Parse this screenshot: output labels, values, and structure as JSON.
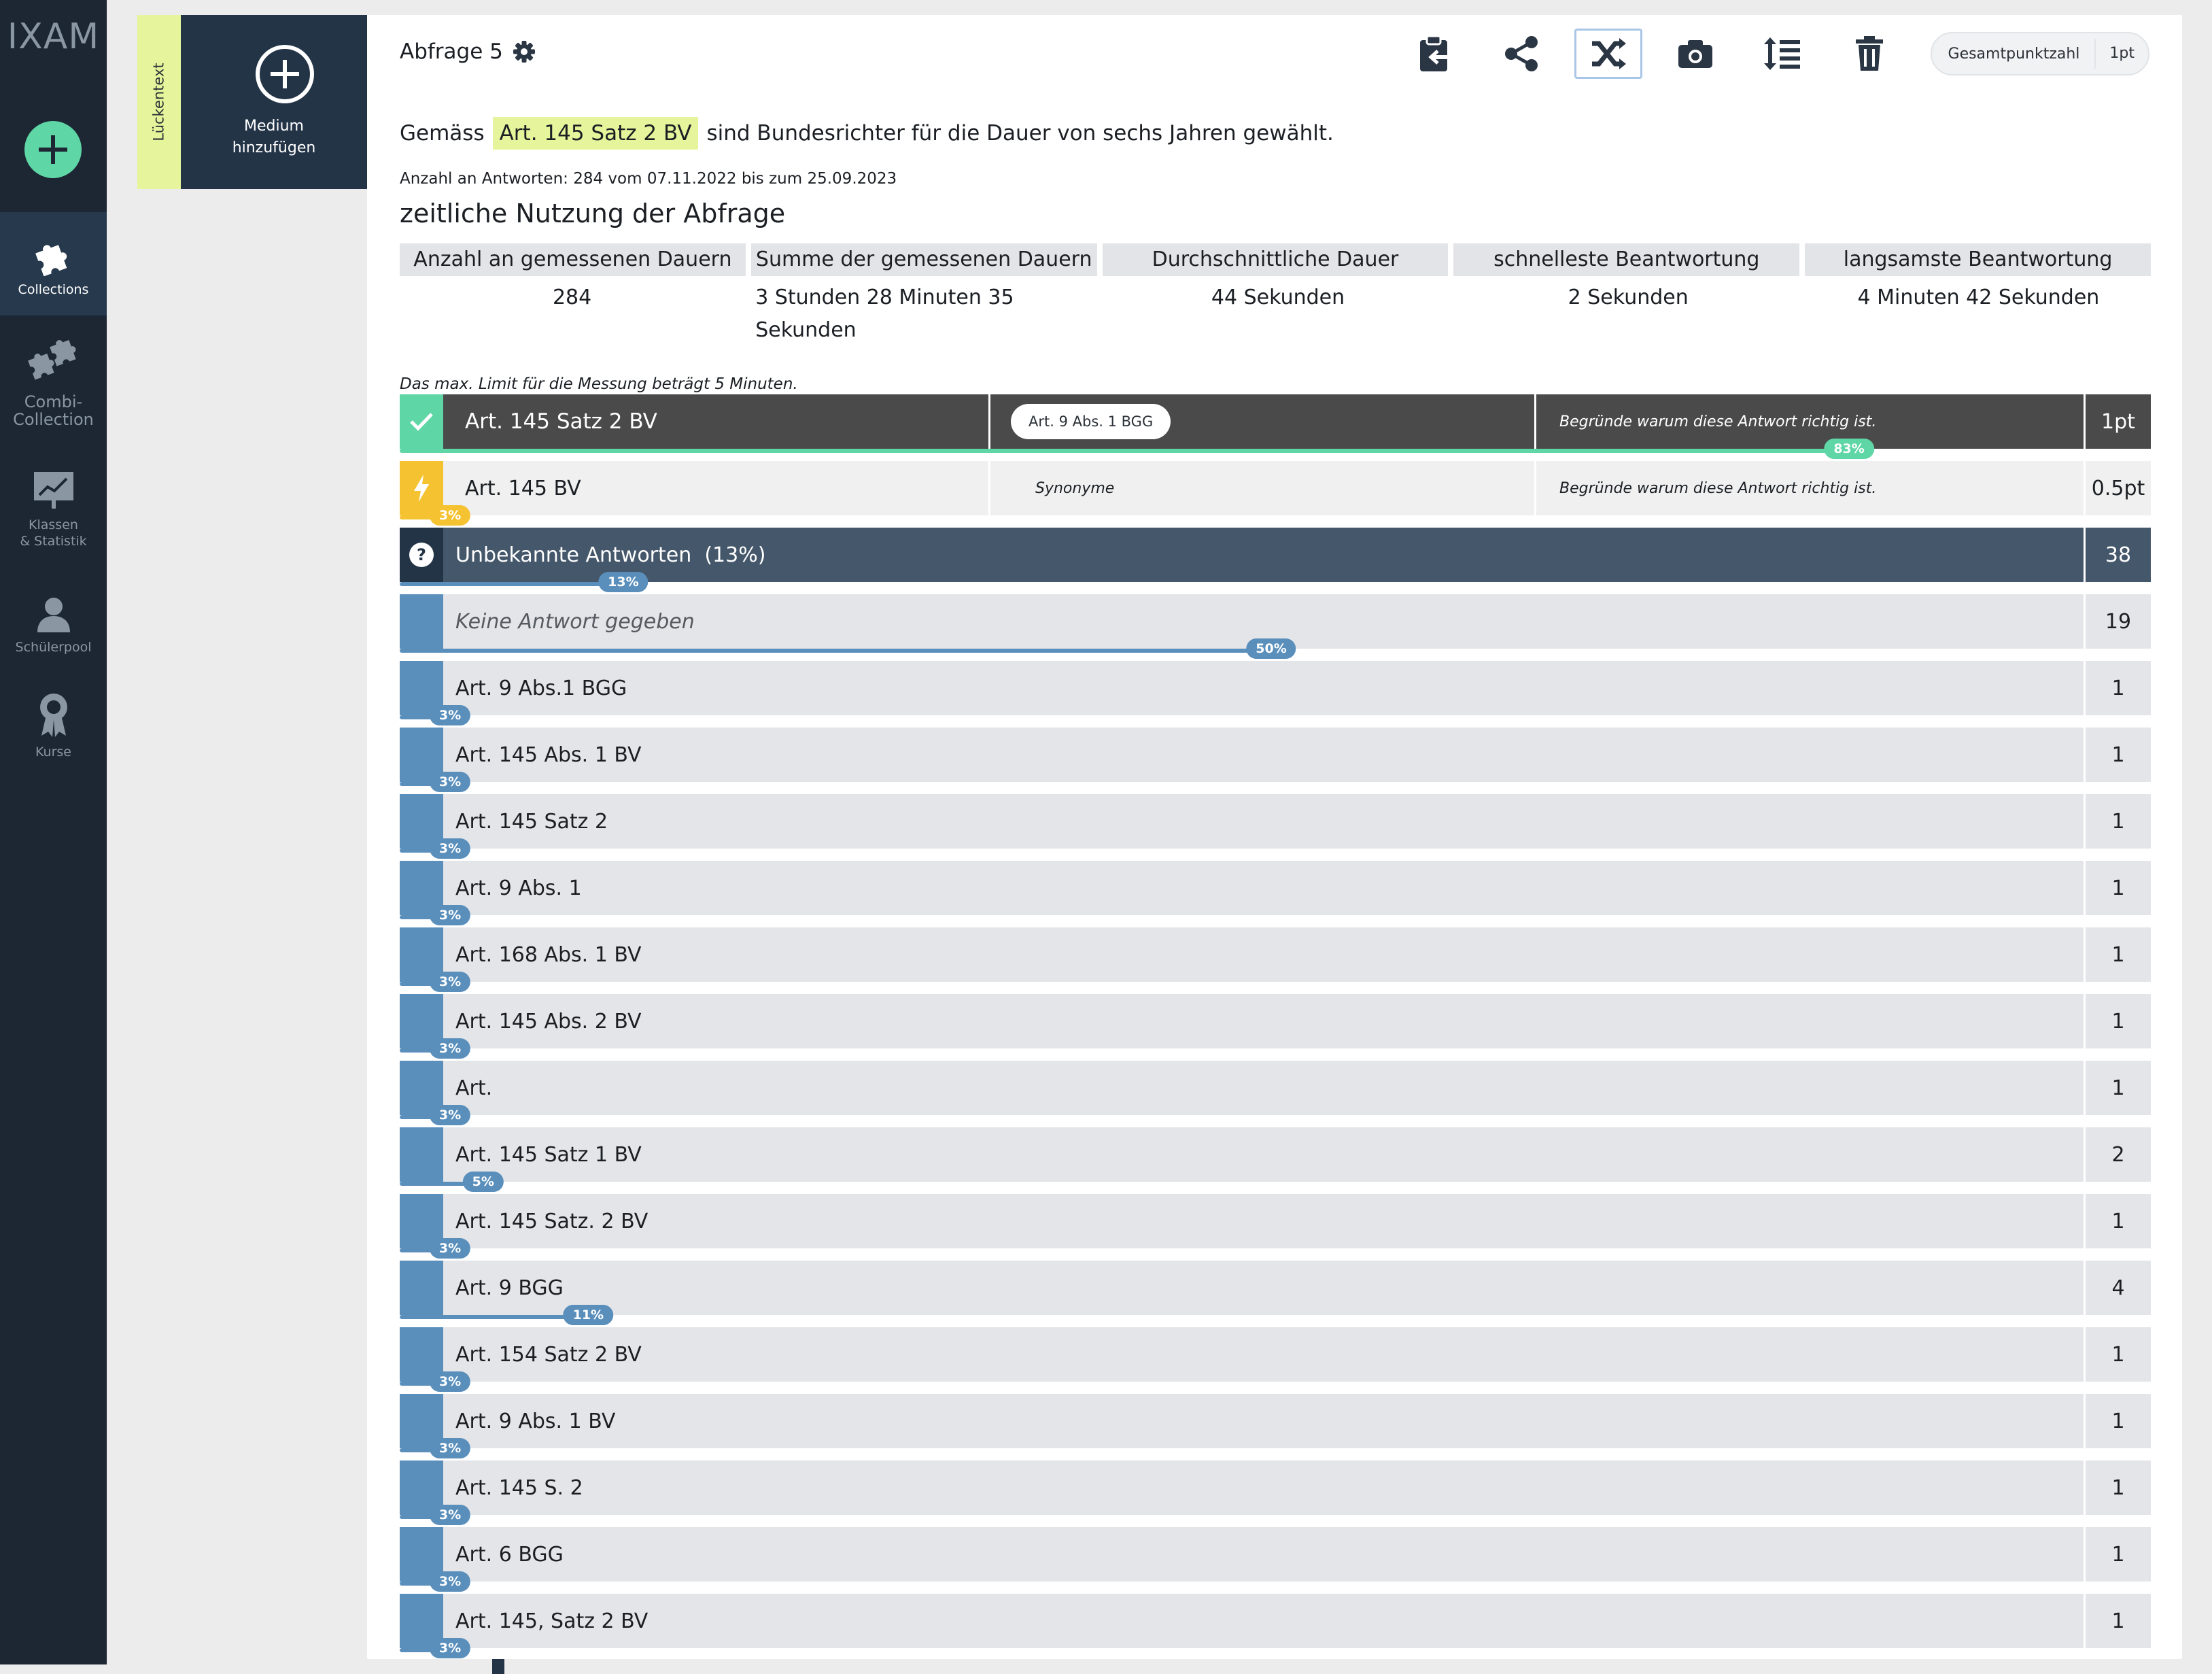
{
  "app": {
    "brand": "IXAM",
    "nav": [
      {
        "label": "Collections",
        "icon": "puzzle-icon"
      },
      {
        "label": "Combi-\nCollection",
        "icon": "puzzle-combi-icon"
      },
      {
        "label": "Klassen\n& Statistik",
        "icon": "chart-board-icon"
      },
      {
        "label": "Schülerpool",
        "icon": "student-icon"
      },
      {
        "label": "Kurse",
        "icon": "award-icon"
      }
    ]
  },
  "media": {
    "type_tag": "Lückentext",
    "add_label_1": "Medium",
    "add_label_2": "hinzufügen"
  },
  "header": {
    "title": "Abfrage 5",
    "points_label": "Gesamtpunktzahl",
    "points_value": "1pt"
  },
  "question": {
    "before": "Gemäss",
    "highlight": "Art. 145 Satz 2 BV",
    "after": "sind Bundesrichter für die Dauer von sechs Jahren gewählt."
  },
  "stats": {
    "answer_count": "Anzahl an Antworten: 284 vom 07.11.2022 bis zum 25.09.2023",
    "section_title": "zeitliche Nutzung der Abfrage",
    "headers": [
      "Anzahl an gemessenen Dauern",
      "Summe der gemessenen Dauern",
      "Durchschnittliche Dauer",
      "schnelleste Beantwortung",
      "langsamste Beantwortung"
    ],
    "values": [
      "284",
      "3 Stunden 28 Minuten 35 Sekunden",
      "44 Sekunden",
      "2 Sekunden",
      "4 Minuten 42 Sekunden"
    ],
    "limit_note": "Das max. Limit für die Messung beträgt 5 Minuten."
  },
  "correct": {
    "answer": "Art. 145 Satz 2 BV",
    "alt_chip": "Art. 9 Abs. 1 BGG",
    "reason": "Begründe warum diese Antwort richtig ist.",
    "points": "1pt",
    "pct_label": "83%",
    "pct": 83,
    "color": "#5fd6a6"
  },
  "synonym": {
    "answer": "Art. 145 BV",
    "col2": "Synonyme",
    "reason": "Begründe warum diese Antwort richtig ist.",
    "points": "0.5pt",
    "pct_label": "3%",
    "pct": 3,
    "color": "#f5c232"
  },
  "unknown": {
    "label": "Unbekannte Antworten",
    "pct_text": "(13%)",
    "count": "38",
    "pct_label": "13%",
    "pct": 13
  },
  "answers": [
    {
      "text": "Keine Antwort gegeben",
      "count": "19",
      "pct_label": "50%",
      "pct": 50,
      "italic": true
    },
    {
      "text": "Art. 9 Abs.1 BGG",
      "count": "1",
      "pct_label": "3%",
      "pct": 3
    },
    {
      "text": "Art. 145 Abs. 1 BV",
      "count": "1",
      "pct_label": "3%",
      "pct": 3
    },
    {
      "text": "Art. 145 Satz 2",
      "count": "1",
      "pct_label": "3%",
      "pct": 3
    },
    {
      "text": "Art. 9 Abs. 1",
      "count": "1",
      "pct_label": "3%",
      "pct": 3
    },
    {
      "text": "Art. 168 Abs. 1 BV",
      "count": "1",
      "pct_label": "3%",
      "pct": 3
    },
    {
      "text": "Art. 145 Abs. 2 BV",
      "count": "1",
      "pct_label": "3%",
      "pct": 3
    },
    {
      "text": "Art.",
      "count": "1",
      "pct_label": "3%",
      "pct": 3
    },
    {
      "text": "Art. 145 Satz 1 BV",
      "count": "2",
      "pct_label": "5%",
      "pct": 5
    },
    {
      "text": "Art. 145 Satz. 2 BV",
      "count": "1",
      "pct_label": "3%",
      "pct": 3
    },
    {
      "text": "Art. 9 BGG",
      "count": "4",
      "pct_label": "11%",
      "pct": 11
    },
    {
      "text": "Art. 154 Satz 2 BV",
      "count": "1",
      "pct_label": "3%",
      "pct": 3
    },
    {
      "text": "Art. 9 Abs. 1 BV",
      "count": "1",
      "pct_label": "3%",
      "pct": 3
    },
    {
      "text": "Art. 145 S. 2",
      "count": "1",
      "pct_label": "3%",
      "pct": 3
    },
    {
      "text": "Art. 6 BGG",
      "count": "1",
      "pct_label": "3%",
      "pct": 3
    },
    {
      "text": "Art. 145, Satz 2 BV",
      "count": "1",
      "pct_label": "3%",
      "pct": 3
    }
  ],
  "colors": {
    "sidebar": "#1c2733",
    "accent_green": "#5fd6a6",
    "accent_yellow": "#f5c232",
    "bar_blue": "#5a8fbc",
    "highlight": "#e6f59b"
  }
}
